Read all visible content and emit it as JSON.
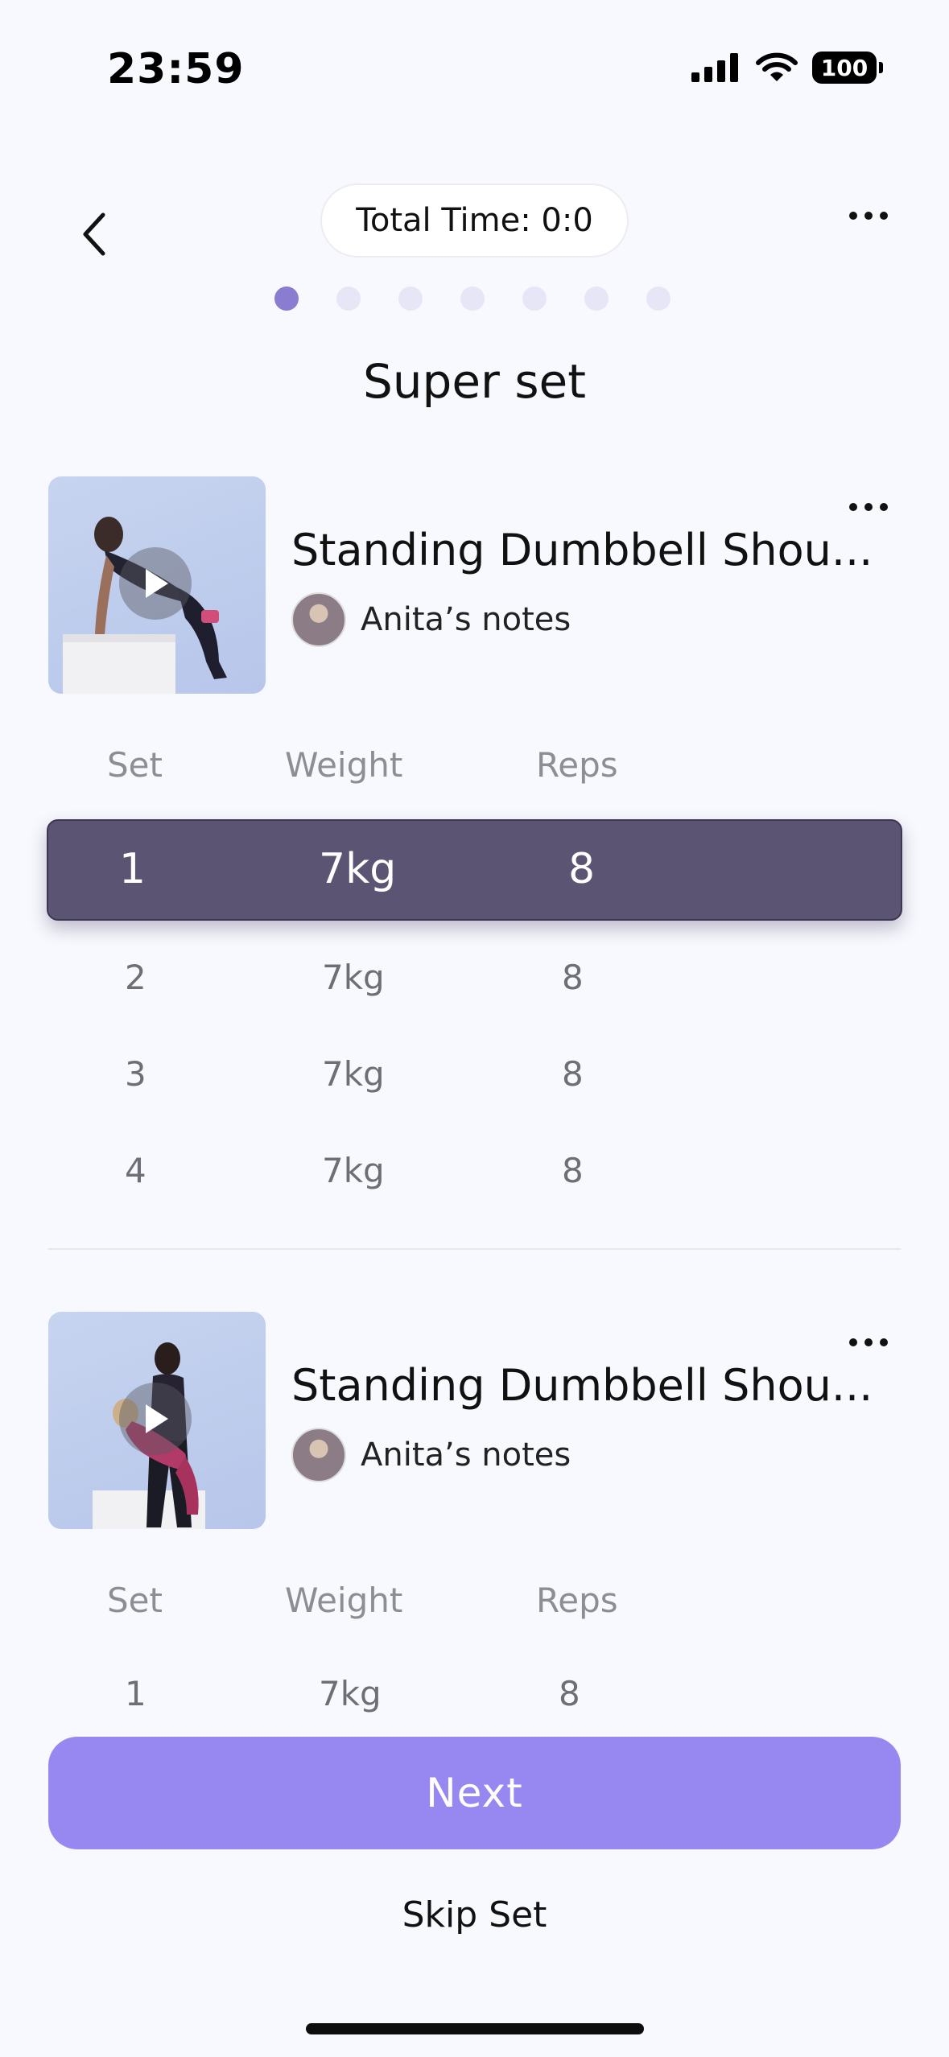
{
  "status_bar": {
    "time": "23:59",
    "battery": "100"
  },
  "header": {
    "total_time_label": "Total Time:",
    "total_time_value": "0:0",
    "pager": {
      "count": 7,
      "active_index": 0
    },
    "title": "Super set"
  },
  "exercises": [
    {
      "name": "Standing Dumbbell Shou...",
      "notes_label": "Anita’s notes",
      "columns": {
        "set": "Set",
        "weight": "Weight",
        "reps": "Reps"
      },
      "rows": [
        {
          "set": "1",
          "weight": "7kg",
          "reps": "8",
          "active": true
        },
        {
          "set": "2",
          "weight": "7kg",
          "reps": "8"
        },
        {
          "set": "3",
          "weight": "7kg",
          "reps": "8"
        },
        {
          "set": "4",
          "weight": "7kg",
          "reps": "8"
        }
      ]
    },
    {
      "name": "Standing Dumbbell Shou...",
      "notes_label": "Anita’s notes",
      "columns": {
        "set": "Set",
        "weight": "Weight",
        "reps": "Reps"
      },
      "rows": [
        {
          "set": "1",
          "weight": "7kg",
          "reps": "8"
        }
      ]
    }
  ],
  "actions": {
    "next_label": "Next",
    "skip_label": "Skip Set"
  },
  "colors": {
    "accent": "#9787f0",
    "active_row": "#5b5472",
    "pager_active": "#8a7cd0",
    "pager_inactive": "#e6e6f7"
  }
}
